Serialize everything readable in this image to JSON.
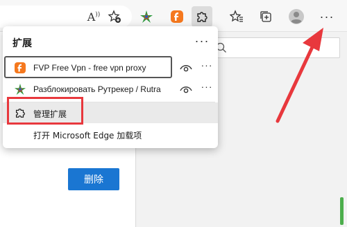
{
  "toolbar": {
    "read_aloud_text": "A",
    "more_label": "···"
  },
  "extensions_panel": {
    "title": "扩展",
    "more_label": "···",
    "items": [
      {
        "label": "FVP Free Vpn - free vpn proxy",
        "more_label": "···"
      },
      {
        "label": "Разблокировать Рутрекер / Rutra",
        "more_label": "···"
      }
    ],
    "manage_label": "管理扩展",
    "open_addons_label": "打开 Microsoft Edge 加载项"
  },
  "page": {
    "delete_button_label": "删除"
  },
  "colors": {
    "accent_blue": "#1a76d2",
    "highlight_red": "#e8383d",
    "fvp_orange": "#f5781e"
  }
}
